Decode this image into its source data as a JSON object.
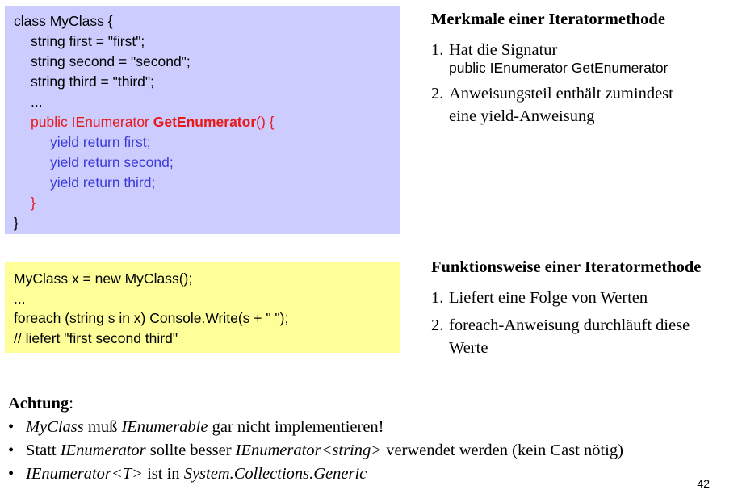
{
  "code_box_1": {
    "line1": "class MyClass {",
    "line2": "string first = \"first\";",
    "line3": "string second = \"second\";",
    "line4": "string third = \"third\";",
    "line5": "...",
    "line6_prefix": "public IEnumerator ",
    "line6_method": "GetEnumerator",
    "line6_suffix": "() {",
    "line7": "yield return first;",
    "line8": "yield return second;",
    "line9": "yield return third;",
    "line10": "}",
    "line11": "}"
  },
  "code_box_2": {
    "line1": "MyClass x = new MyClass();",
    "line2": "...",
    "line3": "foreach (string s in x) Console.Write(s + \" \");",
    "line4": "// liefert \"first second third\""
  },
  "features": {
    "heading": "Merkmale einer Iteratormethode",
    "item1_num": "1.",
    "item1_text": "Hat die Signatur",
    "item1_code": "public IEnumerator GetEnumerator",
    "item2_num": "2.",
    "item2_line1": "Anweisungsteil enthält zumindest",
    "item2_line2": "eine yield-Anweisung"
  },
  "function": {
    "heading": "Funktionsweise einer Iteratormethode",
    "item1_num": "1.",
    "item1_text": "Liefert eine Folge von Werten",
    "item2_num": "2.",
    "item2_line1": "foreach-Anweisung durchläuft diese",
    "item2_line2": "Werte"
  },
  "note": {
    "title": "Achtung",
    "colon": ":",
    "bullet": "•",
    "b1_em1": "MyClass",
    "b1_t1": " muß ",
    "b1_em2": "IEnumerable",
    "b1_t2": " gar nicht implementieren!",
    "b2_t1": "Statt ",
    "b2_em1": "IEnumerator",
    "b2_t2": " sollte besser ",
    "b2_em2": "IEnumerator<string>",
    "b2_t3": " verwendet werden (kein Cast nötig)",
    "b3_em1": "IEnumerator<T>",
    "b3_t1": " ist in ",
    "b3_em2": "System.Collections.Generic"
  },
  "page_number": "42"
}
